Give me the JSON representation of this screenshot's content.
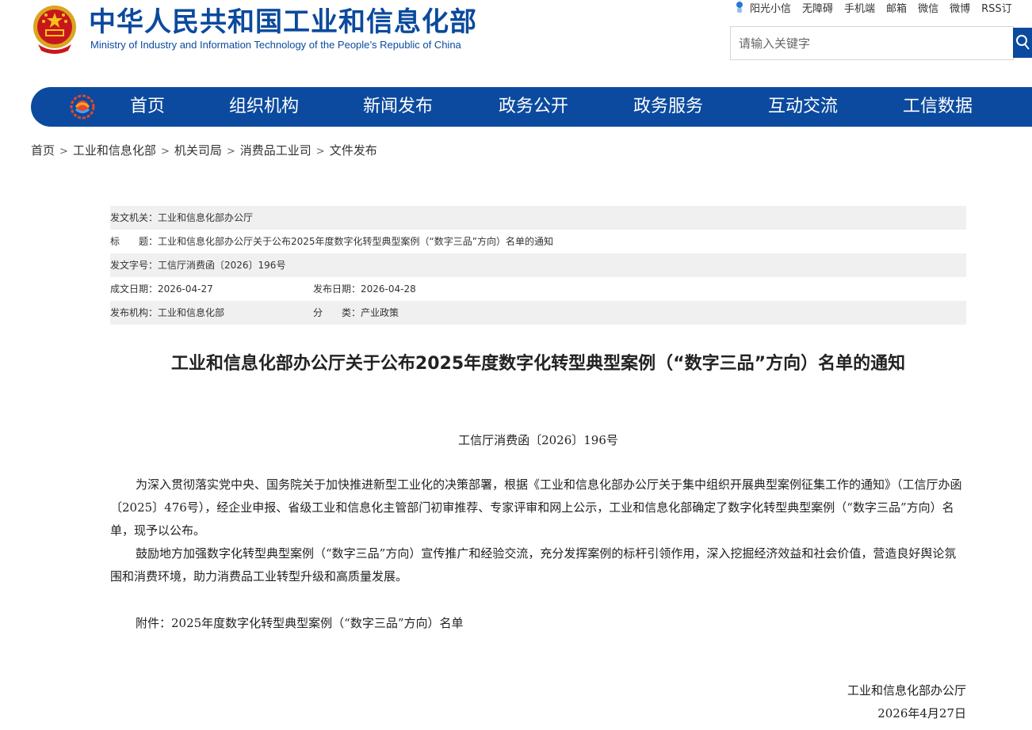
{
  "header": {
    "title_cn": "中华人民共和国工业和信息化部",
    "title_en": "Ministry of Industry and Information Technology of the People’s Republic of China",
    "toplinks": [
      "阳光小信",
      "无障碍",
      "手机端",
      "邮箱",
      "微信",
      "微博",
      "RSS订"
    ],
    "search_placeholder": "请输入关键字",
    "brand_color": "#0b4a9e"
  },
  "nav": {
    "items": [
      "首页",
      "组织机构",
      "新闻发布",
      "政务公开",
      "政务服务",
      "互动交流",
      "工信数据"
    ]
  },
  "breadcrumb": [
    "首页",
    "工业和信息化部",
    "机关司局",
    "消费品工业司",
    "文件发布"
  ],
  "breadcrumb_sep": ">",
  "info": {
    "issuer": "发文机关：工业和信息化部办公厅",
    "title": "标　　题：工业和信息化部办公厅关于公布2025年度数字化转型典型案例（“数字三品”方向）名单的通知",
    "doc_no": "发文字号：工信厅消费函〔2026〕196号",
    "created": "成文日期：2026-04-27",
    "published": "发布日期：2026-04-28",
    "org": "发布机构：工业和信息化部",
    "category": "分　　类：产业政策"
  },
  "article": {
    "title": "工业和信息化部办公厅关于公布2025年度数字化转型典型案例（“数字三品”方向）名单的通知",
    "doc_no": "工信厅消费函〔2026〕196号",
    "para1": "为深入贯彻落实党中央、国务院关于加快推进新型工业化的决策部署，根据《工业和信息化部办公厅关于集中组织开展典型案例征集工作的通知》（工信厅办函〔2025〕476号），经企业申报、省级工业和信息化主管部门初审推荐、专家评审和网上公示，工业和信息化部确定了数字化转型典型案例（“数字三品”方向）名单，现予以公布。",
    "para2": "鼓励地方加强数字化转型典型案例（“数字三品”方向）宣传推广和经验交流，充分发挥案例的标杆引领作用，深入挖掘经济效益和社会价值，营造良好舆论氛围和消费环境，助力消费品工业转型升级和高质量发展。",
    "attachment": "附件：2025年度数字化转型典型案例（“数字三品”方向）名单",
    "sign_org": "工业和信息化部办公厅",
    "sign_date": "2026年4月27日"
  }
}
